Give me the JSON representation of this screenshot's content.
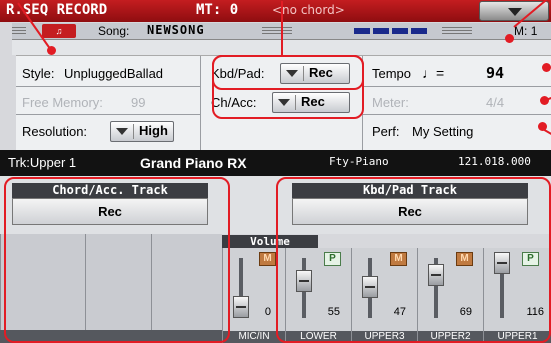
{
  "title_bar": {
    "title": "R.SEQ RECORD",
    "mt": "MT: 0",
    "chord": "<no chord>"
  },
  "song_bar": {
    "song_label": "Song:",
    "song_name": "NEWSONG",
    "measure_label": "M:",
    "measure": "1"
  },
  "info": {
    "style_label": "Style:",
    "style_value": "UnpluggedBallad",
    "free_memory_label": "Free Memory:",
    "free_memory_value": "99",
    "resolution_label": "Resolution:",
    "resolution_value": "High",
    "kbd_pad_label": "Kbd/Pad:",
    "kbd_pad_value": "Rec",
    "ch_acc_label": "Ch/Acc:",
    "ch_acc_value": "Rec",
    "tempo_label": "Tempo",
    "tempo_note": "♩=",
    "tempo_value": "94",
    "meter_label": "Meter:",
    "meter_value": "4/4",
    "perf_label": "Perf:",
    "perf_value": "My Setting"
  },
  "track": {
    "trk": "Trk:Upper 1",
    "sound": "Grand Piano RX",
    "family": "Fty-Piano",
    "program": "121.018.000"
  },
  "tracks_section": {
    "chord_header": "Chord/Acc. Track",
    "chord_rec": "Rec",
    "kbd_header": "Kbd/Pad Track",
    "kbd_rec": "Rec",
    "volume_header": "Volume"
  },
  "channels": [
    {
      "name": "MIC/IN",
      "volume": "0",
      "button": "M"
    },
    {
      "name": "LOWER",
      "volume": "55",
      "button": "P"
    },
    {
      "name": "UPPER3",
      "volume": "47",
      "button": "M"
    },
    {
      "name": "UPPER2",
      "volume": "69",
      "button": "M"
    },
    {
      "name": "UPPER1",
      "volume": "116",
      "button": "P"
    }
  ],
  "colors": {
    "title_red": "#c41d20",
    "callout_red": "#e21c24",
    "rec_blue": "#1a2a8c"
  }
}
